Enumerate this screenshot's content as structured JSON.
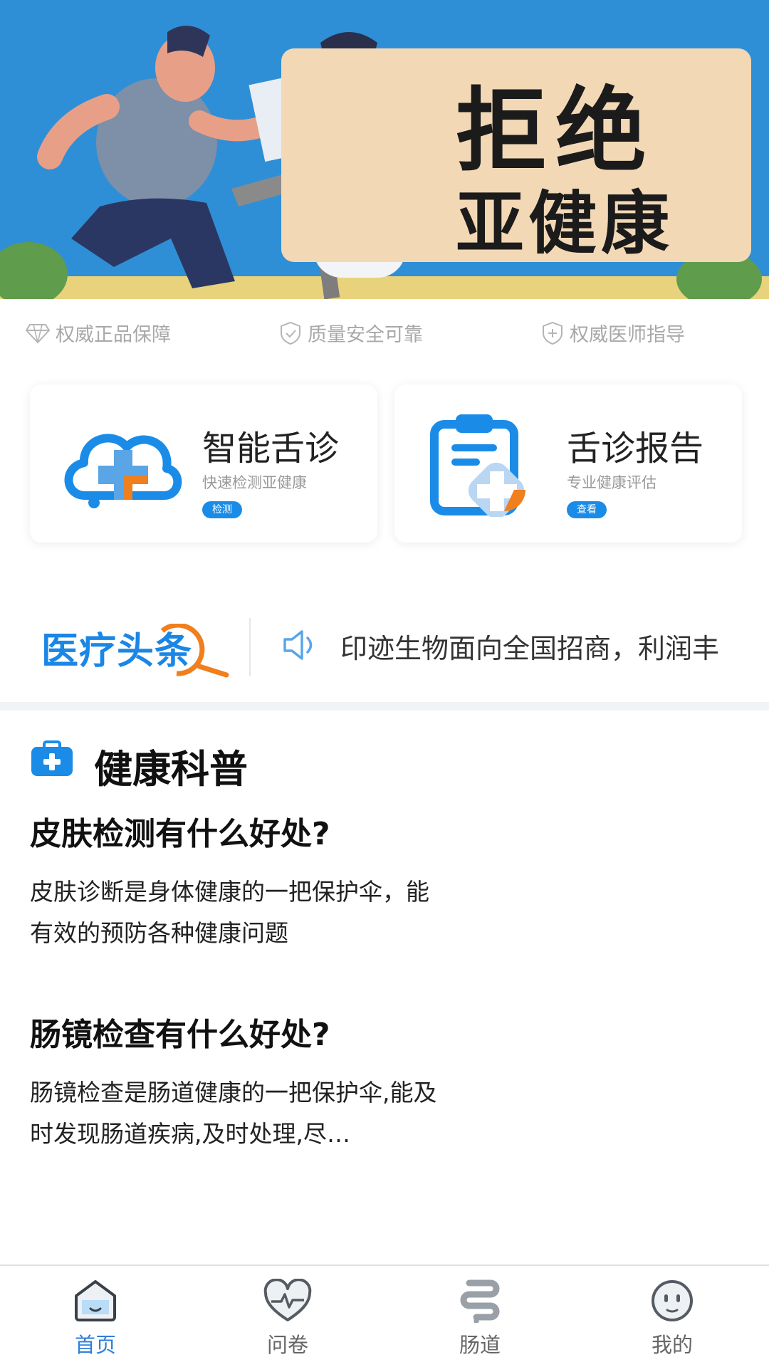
{
  "banner": {
    "title_line1": "拒绝",
    "title_line2": "亚健康"
  },
  "guarantees": [
    {
      "label": "权威正品保障",
      "icon": "diamond-icon"
    },
    {
      "label": "质量安全可靠",
      "icon": "shield-check-icon"
    },
    {
      "label": "权威医师指导",
      "icon": "medical-shield-icon"
    }
  ],
  "features": [
    {
      "title": "智能舌诊",
      "subtitle": "快速检测亚健康",
      "button": "检测",
      "icon": "cloud-medical-icon"
    },
    {
      "title": "舌诊报告",
      "subtitle": "专业健康评估",
      "button": "查看",
      "icon": "clipboard-medical-icon"
    }
  ],
  "headline": {
    "logo": "医疗头条",
    "text": "印迹生物面向全国招商，利润丰"
  },
  "science": {
    "title": "健康科普",
    "articles": [
      {
        "title": "皮肤检测有什么好处?",
        "body": "皮肤诊断是身体健康的一把保护伞，能有效的预防各种健康问题"
      },
      {
        "title": "肠镜检查有什么好处?",
        "body": "肠镜检查是肠道健康的一把保护伞,能及时发现肠道疾病,及时处理,尽…"
      }
    ]
  },
  "nav": [
    {
      "label": "首页",
      "icon": "home-icon",
      "active": true
    },
    {
      "label": "问卷",
      "icon": "heart-pulse-icon",
      "active": false
    },
    {
      "label": "肠道",
      "icon": "intestine-icon",
      "active": false
    },
    {
      "label": "我的",
      "icon": "profile-face-icon",
      "active": false
    }
  ],
  "colors": {
    "accent": "#1a8ce8",
    "banner_bg": "#2f8fd6",
    "banner_card": "#f3d8b6",
    "nav_active": "#2f7fd8"
  }
}
